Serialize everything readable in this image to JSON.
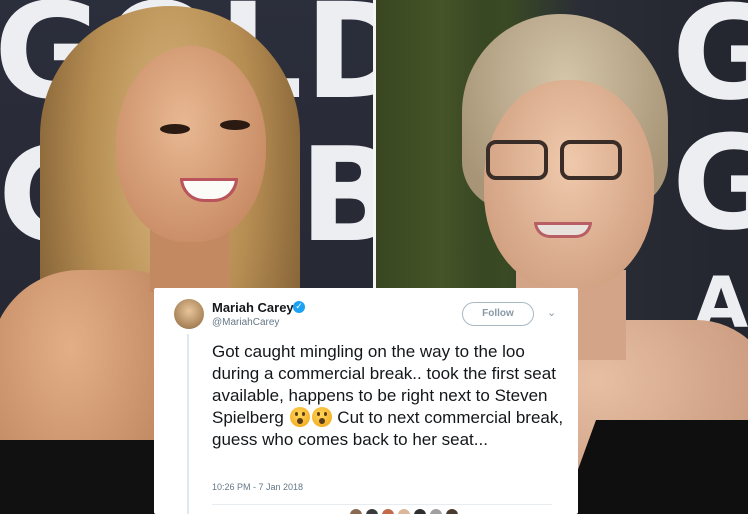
{
  "backdrop": {
    "left_line1": "GOLDEN",
    "left_line2": "GLOBE",
    "right_line1": "G",
    "right_line2": "G",
    "right_line3": "A"
  },
  "tweet": {
    "name": "Mariah Carey",
    "handle": "@MariahCarey",
    "verified_icon": "✓",
    "follow_label": "Follow",
    "menu_icon": "⌄",
    "text_part1": "Got caught mingling on the way to the loo during a commercial break.. took the first seat available, happens to be right next to Steven Spielberg",
    "text_part2": "Cut to next commercial break, guess who comes back to her seat...",
    "emoji": "astonished-face-emoji",
    "timestamp": "10:26 PM - 7 Jan 2018"
  },
  "colors": {
    "verified": "#1da1f2",
    "text": "#14171a",
    "secondary": "#657786"
  }
}
